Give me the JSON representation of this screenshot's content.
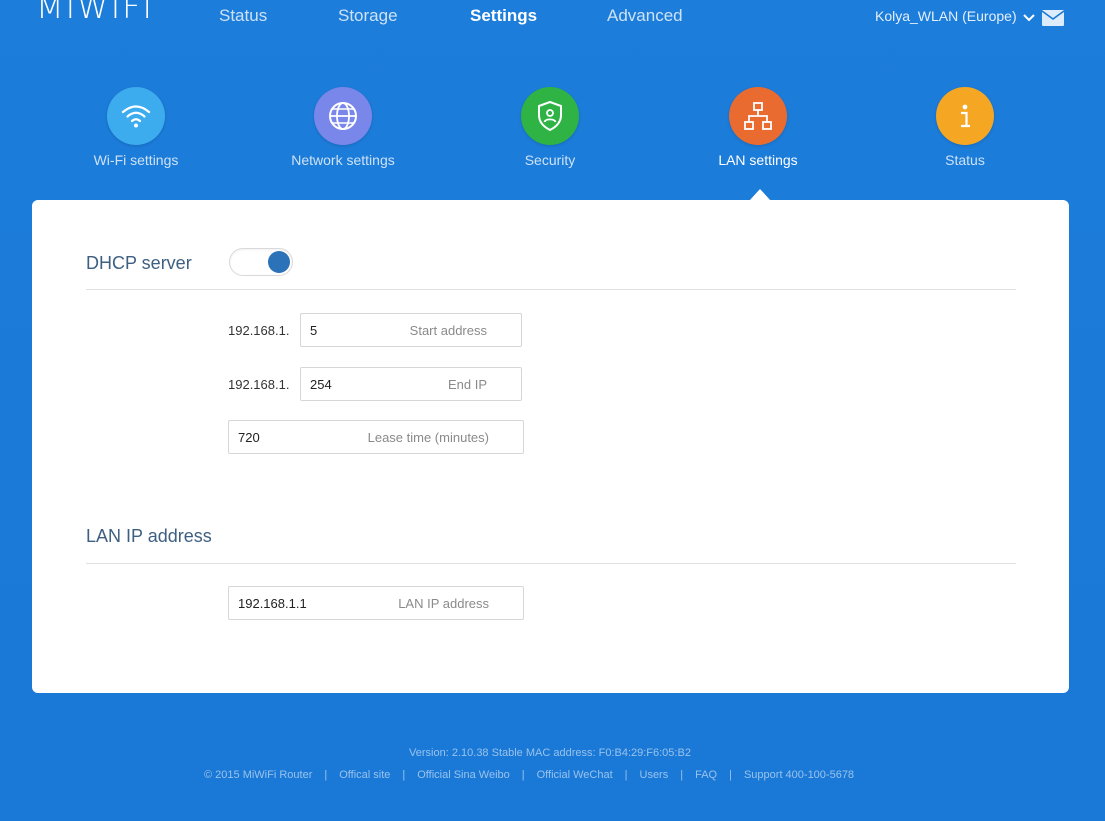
{
  "brand": {
    "logo_text": "MIWIFI"
  },
  "topnav": {
    "items": [
      {
        "label": "Status",
        "active": false
      },
      {
        "label": "Storage",
        "active": false
      },
      {
        "label": "Settings",
        "active": true
      },
      {
        "label": "Advanced",
        "active": false
      }
    ],
    "network_name": "Kolya_WLAN (Europe)",
    "mail_icon": "envelope-icon"
  },
  "categories": [
    {
      "label": "Wi-Fi settings",
      "icon": "wifi-icon",
      "color": "#3dacef",
      "active": false
    },
    {
      "label": "Network settings",
      "icon": "globe-icon",
      "color": "#7a87ea",
      "active": false
    },
    {
      "label": "Security",
      "icon": "shield-icon",
      "color": "#2fb344",
      "active": false
    },
    {
      "label": "LAN settings",
      "icon": "network-tree-icon",
      "color": "#ea6b2f",
      "active": true
    },
    {
      "label": "Status",
      "icon": "info-icon",
      "color": "#f5a623",
      "active": false
    }
  ],
  "dhcp": {
    "title": "DHCP server",
    "enabled": true,
    "ip_prefix": "192.168.1.",
    "start": {
      "value": "5",
      "hint": "Start address"
    },
    "end": {
      "value": "254",
      "hint": "End IP"
    },
    "lease": {
      "value": "720",
      "hint": "Lease time (minutes)"
    }
  },
  "lan": {
    "title": "LAN IP address",
    "ip": {
      "value": "192.168.1.1",
      "hint": "LAN IP address"
    }
  },
  "footer": {
    "version": "Version: 2.10.38 Stable  MAC address: F0:B4:29:F6:05:B2",
    "copyright": "© 2015 MiWiFi Router",
    "links": [
      "Offical site",
      "Official Sina Weibo",
      "Official WeChat",
      "Users",
      "FAQ",
      "Support 400-100-5678"
    ]
  },
  "colors": {
    "background": "#1b7ad7",
    "panel": "#ffffff",
    "section_title": "#3d5f82",
    "toggle_on": "#2c72b9"
  }
}
